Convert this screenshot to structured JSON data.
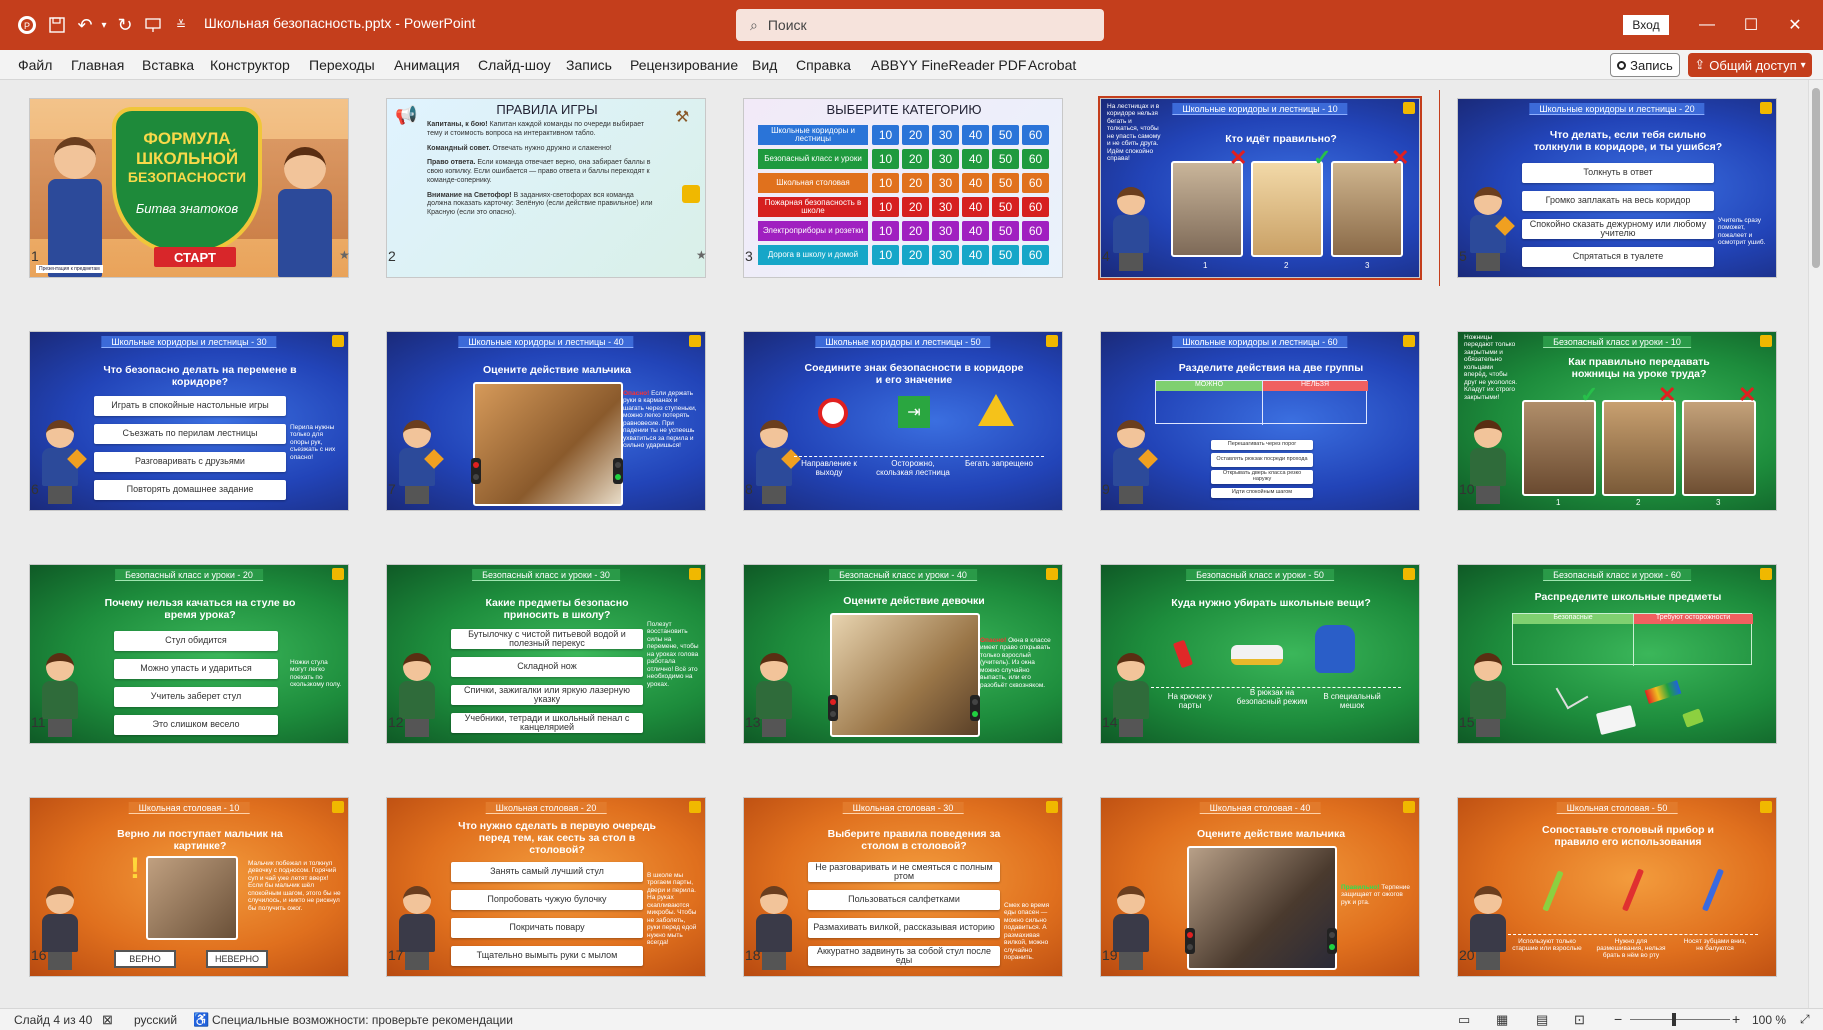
{
  "window": {
    "doc_title": "Школьная безопасность.pptx  -  PowerPoint",
    "search_placeholder": "Поиск",
    "signin": "Вход"
  },
  "ribbon": {
    "tabs": [
      "Файл",
      "Главная",
      "Вставка",
      "Конструктор",
      "Переходы",
      "Анимация",
      "Слайд-шоу",
      "Запись",
      "Рецензирование",
      "Вид",
      "Справка",
      "ABBYY FineReader PDF",
      "Acrobat"
    ],
    "record": "Запись",
    "share": "Общий доступ"
  },
  "status": {
    "slide": "Слайд 4 из 40",
    "lang": "русский",
    "accessibility": "Специальные возможности: проверьте рекомендации",
    "zoom": "100 %"
  },
  "slides": {
    "s1": {
      "num": "1",
      "t1": "ФОРМУЛА",
      "t2": "ШКОЛЬНОЙ",
      "t3": "БЕЗОПАСНОСТИ",
      "sub": "Битва знатоков",
      "btn": "СТАРТ",
      "logo": "Презентация к предметам"
    },
    "s2": {
      "num": "2",
      "title": "ПРАВИЛА ИГРЫ",
      "r1b": "Капитаны, к бою!",
      "r1": " Капитан каждой команды по очереди выбирает тему и стоимость вопроса на интерактивном табло.",
      "r2b": "Командный совет.",
      "r2": " Отвечать нужно дружно и слаженно!",
      "r3b": "Право ответа.",
      "r3": " Если команда отвечает верно, она забирает баллы в свою копилку. Если ошибается — право ответа и баллы переходят к команде-сопернику.",
      "r4b": "Внимание на Светофор!",
      "r4": " В заданиях-светофорах вся команда должна показать карточку: Зелёную (если действие правильное) или Красную (если это опасно)."
    },
    "s3": {
      "num": "3",
      "title": "ВЫБЕРИТЕ КАТЕГОРИЮ",
      "cats": [
        "Школьные коридоры и лестницы",
        "Безопасный класс и уроки",
        "Школьная столовая",
        "Пожарная безопасность в школе",
        "Электроприборы и розетки",
        "Дорога в школу и домой"
      ],
      "pts": [
        "10",
        "20",
        "30",
        "40",
        "50",
        "60"
      ]
    },
    "s4": {
      "num": "4",
      "hdr": "Школьные коридоры и лестницы - 10",
      "q": "Кто идёт правильно?",
      "side": "На лестницах и в коридоре нельзя бегать и толкаться, чтобы не упасть самому и не сбить друга. Идём спокойно справа!",
      "p1": "1",
      "p2": "2",
      "p3": "3"
    },
    "s5": {
      "num": "5",
      "hdr": "Школьные коридоры и лестницы - 20",
      "q": "Что делать, если тебя сильно толкнули в коридоре, и ты ушибся?",
      "opts": [
        "Толкнуть в ответ",
        "Громко заплакать на весь коридор",
        "Спокойно сказать дежурному или любому учителю",
        "Спрятаться в туалете"
      ],
      "side": "Учитель сразу поможет, пожалеет и осмотрит ушиб."
    },
    "s6": {
      "num": "6",
      "hdr": "Школьные коридоры и лестницы - 30",
      "q": "Что безопасно делать на перемене в коридоре?",
      "opts": [
        "Играть в спокойные настольные игры",
        "Съезжать по перилам лестницы",
        "Разговаривать с друзьями",
        "Повторять домашнее задание"
      ],
      "side": "Перила нужны только для опоры рук, съезжать с них опасно!"
    },
    "s7": {
      "num": "7",
      "hdr": "Школьные коридоры и лестницы - 40",
      "q": "Оцените действие мальчика",
      "side_red": "Опасно!",
      "side": " Если держать руки в карманах и шагать через ступеньки, можно легко потерять равновесие. При падении ты не успеешь ухватиться за перила и сильно ударишься!"
    },
    "s8": {
      "num": "8",
      "hdr": "Школьные коридоры и лестницы - 50",
      "q": "Соедините знак безопасности в коридоре и его значение",
      "a1": "Направление к выходу",
      "a2": "Осторожно, скользкая лестница",
      "a3": "Бегать запрещено"
    },
    "s9": {
      "num": "9",
      "hdr": "Школьные коридоры и лестницы - 60",
      "q": "Разделите действия на две группы",
      "can": "МОЖНО",
      "cant": "НЕЛЬЗЯ",
      "items": [
        "Перешагивать через порог",
        "Оставлять рюкзак посреди прохода",
        "Открывать дверь класса резко наружу",
        "Идти спокойным шагом"
      ]
    },
    "s10": {
      "num": "10",
      "hdr": "Безопасный класс и уроки - 10",
      "q": "Как правильно передавать ножницы на уроке труда?",
      "side": "Ножницы передают только закрытыми и обязательно кольцами вперёд, чтобы друг не укололся. Кладут их строго закрытыми!",
      "p1": "1",
      "p2": "2",
      "p3": "3"
    },
    "s11": {
      "num": "11",
      "hdr": "Безопасный класс и уроки - 20",
      "q": "Почему нельзя качаться на стуле во время урока?",
      "opts": [
        "Стул обидится",
        "Можно упасть и удариться",
        "Учитель заберет стул",
        "Это слишком весело"
      ],
      "side": "Ножки стула могут легко поехать по скользкому полу."
    },
    "s12": {
      "num": "12",
      "hdr": "Безопасный класс и уроки - 30",
      "q": "Какие предметы безопасно приносить в школу?",
      "opts": [
        "Бутылочку с чистой питьевой водой и полезный перекус",
        "Складной нож",
        "Спички, зажигалки или яркую лазерную указку",
        "Учебники, тетради и школьный пенал с канцелярией"
      ],
      "side": "Полезут восстановить силы на перемене, чтобы на уроках голова работала отлично! Всё это необходимо на уроках."
    },
    "s13": {
      "num": "13",
      "hdr": "Безопасный класс и уроки - 40",
      "q": "Оцените действие девочки",
      "side_red": "Опасно!",
      "side": " Окна в классе имеет право открывать только взрослый (учитель). Из окна можно случайно выпасть, или его разобьёт сквозняком."
    },
    "s14": {
      "num": "14",
      "hdr": "Безопасный класс и уроки - 50",
      "q": "Куда нужно убирать школьные вещи?",
      "a1": "На крючок у парты",
      "a2": "В рюкзак на безопасный режим",
      "a3": "В специальный мешок"
    },
    "s15": {
      "num": "15",
      "hdr": "Безопасный класс и уроки - 60",
      "q": "Распределите школьные предметы",
      "safe": "Безопасные",
      "careful": "Требуют осторожности"
    },
    "s16": {
      "num": "16",
      "hdr": "Школьная столовая - 10",
      "q": "Верно ли поступает мальчик на картинке?",
      "side": "Мальчик побежал и толкнул девочку с подносом. Горячий суп и чай уже летят вверх! Если бы мальчик шёл спокойным шагом, этого бы не случилось, и никто не рискнул бы получить ожог.",
      "yes": "ВЕРНО",
      "no": "НЕВЕРНО"
    },
    "s17": {
      "num": "17",
      "hdr": "Школьная столовая - 20",
      "q": "Что нужно сделать в первую очередь перед тем, как сесть за стол в столовой?",
      "opts": [
        "Занять самый лучший стул",
        "Попробовать чужую булочку",
        "Покричать повару",
        "Тщательно вымыть руки с мылом"
      ],
      "side": "В школе мы трогаем парты, двери и перила. На руках скапливаются микробы. Чтобы не заболеть, руки перед едой нужно мыть всегда!"
    },
    "s18": {
      "num": "18",
      "hdr": "Школьная столовая - 30",
      "q": "Выберите правила поведения за столом в столовой?",
      "opts": [
        "Не разговаривать и не смеяться с полным ртом",
        "Пользоваться салфетками",
        "Размахивать вилкой, рассказывая историю",
        "Аккуратно задвинуть за собой стул после еды"
      ],
      "side": "Смех во время еды опасен — можно сильно подавиться. А размахивая вилкой, можно случайно поранить."
    },
    "s19": {
      "num": "19",
      "hdr": "Школьная столовая - 40",
      "q": "Оцените действие мальчика",
      "side_green": "Правильно!",
      "side": " Терпение защищает от ожогов рук и рта."
    },
    "s20": {
      "num": "20",
      "hdr": "Школьная столовая - 50",
      "q": "Сопоставьте столовый прибор и правило его использования",
      "a1": "Используют только старшие или взрослые",
      "a2": "Нужно для размешивания, нельзя брать в нём во рту",
      "a3": "Носят зубцами вниз, не балуются"
    }
  }
}
